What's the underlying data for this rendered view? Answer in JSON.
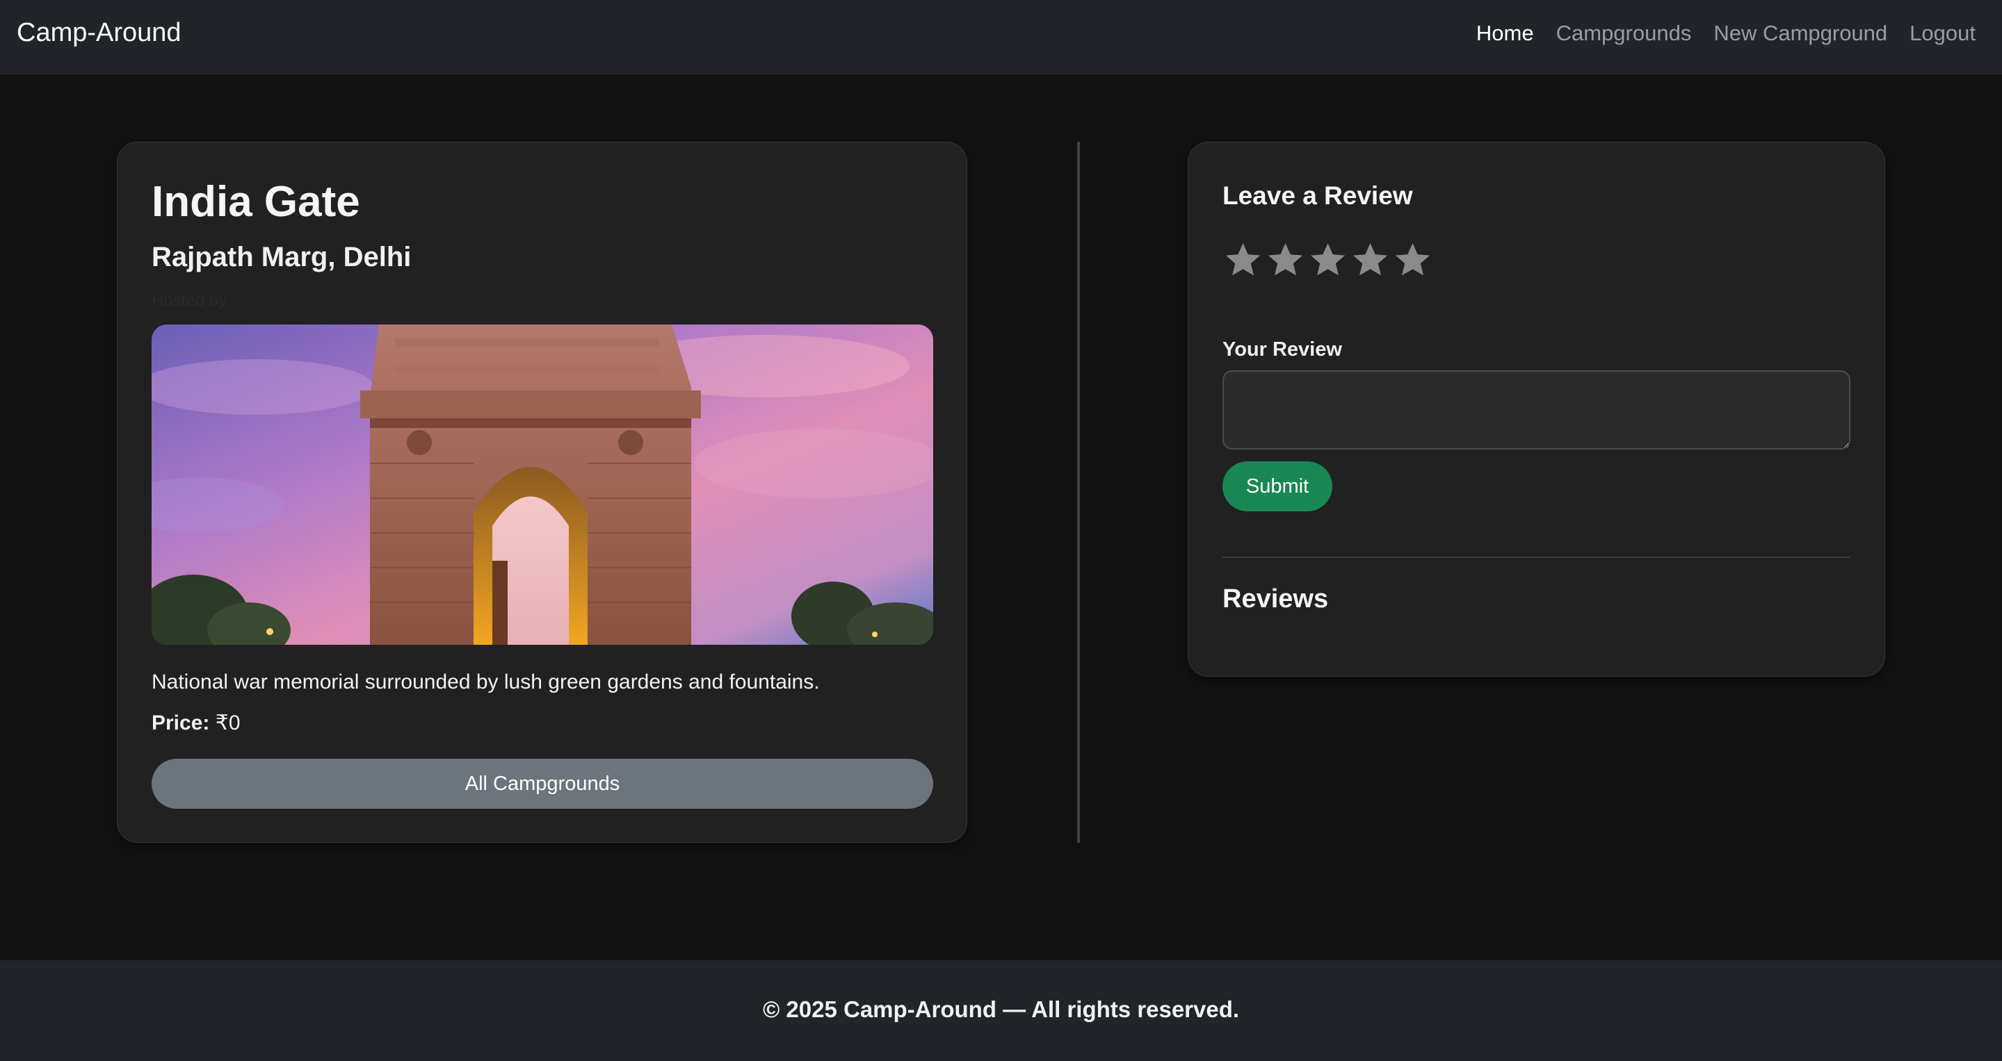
{
  "navbar": {
    "brand": "Camp-Around",
    "links": [
      {
        "label": "Home",
        "active": true
      },
      {
        "label": "Campgrounds",
        "active": false
      },
      {
        "label": "New Campground",
        "active": false
      },
      {
        "label": "Logout",
        "active": false
      }
    ]
  },
  "campground": {
    "title": "India Gate",
    "location": "Rajpath Marg, Delhi",
    "author": "Hosted by",
    "description": "National war memorial surrounded by lush green gardens and fountains.",
    "price_label": "Price:",
    "price_value": "₹0",
    "all_button": "All Campgrounds"
  },
  "review_form": {
    "heading": "Leave a Review",
    "star_count": 5,
    "rating": 0,
    "review_label": "Your Review",
    "review_value": "",
    "submit_label": "Submit"
  },
  "reviews": {
    "heading": "Reviews",
    "items": []
  },
  "footer": {
    "text": "© 2025 Camp-Around — All rights reserved."
  },
  "colors": {
    "background": "#121212",
    "navbar": "#212529",
    "card": "#212121",
    "secondary_button": "#6c757d",
    "success_button": "#198754",
    "star_empty": "#8a8a8a"
  }
}
